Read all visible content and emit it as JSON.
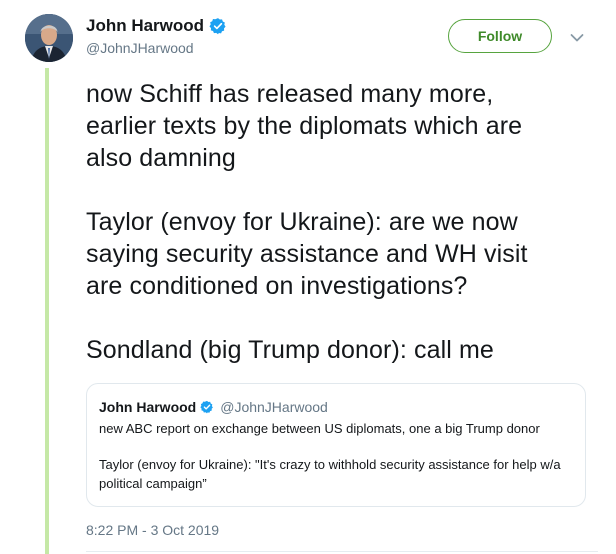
{
  "author": {
    "name": "John Harwood",
    "handle": "@JohnJHarwood",
    "verified_icon": "verified-badge-icon"
  },
  "follow_label": "Follow",
  "menu_icon": "chevron-down-icon",
  "tweet": {
    "paragraphs": [
      "now Schiff has released many more,\nearlier texts by the diplomats which are\nalso damning",
      "Taylor (envoy for Ukraine): are we now\nsaying security assistance and WH visit\nare conditioned on investigations?",
      "Sondland (big Trump donor): call me"
    ]
  },
  "quote": {
    "name": "John Harwood",
    "handle": "@JohnJHarwood",
    "paragraphs": [
      "new ABC report on exchange between US diplomats, one a big Trump donor",
      "Taylor (envoy for Ukraine): \"It's crazy to withhold security assistance for help w/a political campaign”"
    ]
  },
  "timestamp": "8:22 PM - 3 Oct 2019",
  "colors": {
    "accent_green": "#57a43f",
    "thread_line": "#c5e8a6",
    "verified_blue": "#1da1f2",
    "muted_text": "#657786"
  }
}
